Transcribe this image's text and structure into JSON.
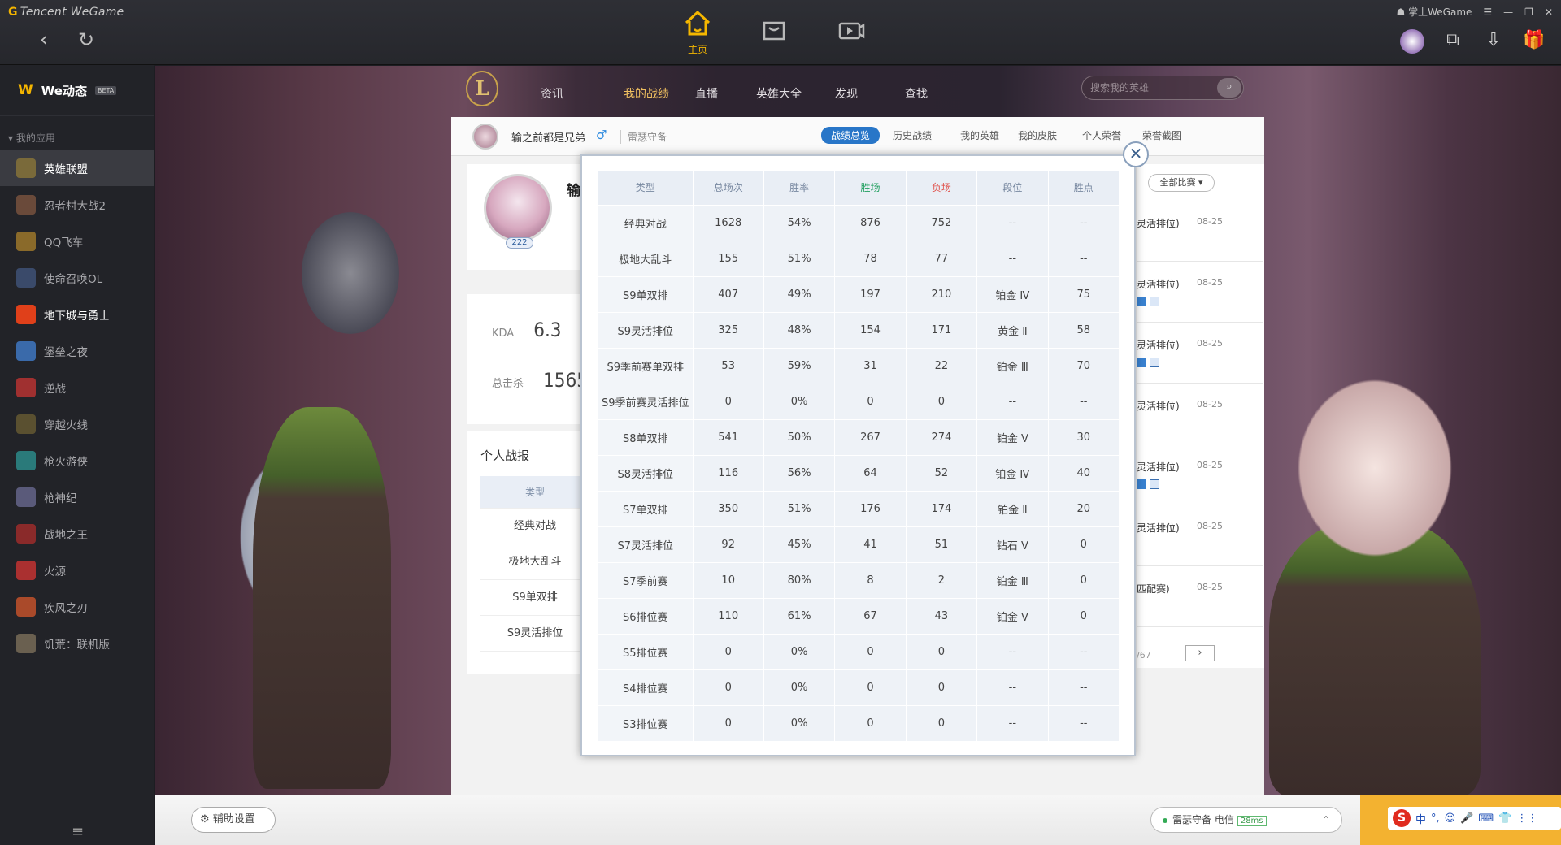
{
  "topbar": {
    "brand": "Tencent WeGame",
    "home_label": "主页",
    "window_right": {
      "login": "掌上WeGame",
      "menu": "☰",
      "min": "—",
      "max": "❐",
      "close": "✕"
    }
  },
  "sidebar": {
    "we_title": "We动态",
    "beta": "BETA",
    "section": "▾ 我的应用",
    "items": [
      {
        "label": "英雄联盟",
        "color": "#7a6a3a"
      },
      {
        "label": "忍者村大战2",
        "color": "#6a4a3a"
      },
      {
        "label": "QQ飞车",
        "color": "#8a6a2a"
      },
      {
        "label": "使命召唤OL",
        "color": "#3a4a6a"
      },
      {
        "label": "地下城与勇士",
        "color": "#e0401a"
      },
      {
        "label": "堡垒之夜",
        "color": "#3a6aaa"
      },
      {
        "label": "逆战",
        "color": "#a03030"
      },
      {
        "label": "穿越火线",
        "color": "#5a5030"
      },
      {
        "label": "枪火游侠",
        "color": "#2a7a7a"
      },
      {
        "label": "枪神纪",
        "color": "#5a5a7a"
      },
      {
        "label": "战地之王",
        "color": "#8a2a2a"
      },
      {
        "label": "火源",
        "color": "#aa3030"
      },
      {
        "label": "疾风之刃",
        "color": "#aa4a2a"
      },
      {
        "label": "饥荒：联机版",
        "color": "#6a6050"
      }
    ]
  },
  "lol": {
    "logo": "L",
    "nav": [
      "资讯",
      "我的战绩",
      "直播",
      "英雄大全",
      "发现",
      "查找"
    ],
    "search_placeholder": "搜索我的英雄"
  },
  "summoner": {
    "name": "输之前都是兄弟",
    "gender": "♂",
    "server": "雷瑟守备",
    "tabs": [
      "战绩总览",
      "历史战绩",
      "我的英雄",
      "我的皮肤",
      "个人荣誉",
      "荣誉截图"
    ],
    "name_fragment": "输",
    "level": "222"
  },
  "kda": {
    "kda_label": "KDA",
    "kda_value": "6.3",
    "kills_label": "总击杀",
    "kills_value": "1565"
  },
  "report": {
    "title": "个人战报",
    "header": "类型",
    "rows": [
      "经典对战",
      "极地大乱斗",
      "S9单双排",
      "S9灵活排位"
    ]
  },
  "matches": {
    "filter": "全部比赛 ▾",
    "rows": [
      {
        "type": "灵活排位)",
        "date": "08-25"
      },
      {
        "type": "灵活排位)",
        "date": "08-25"
      },
      {
        "type": "灵活排位)",
        "date": "08-25"
      },
      {
        "type": "灵活排位)",
        "date": "08-25"
      },
      {
        "type": "灵活排位)",
        "date": "08-25"
      },
      {
        "type": "灵活排位)",
        "date": "08-25"
      },
      {
        "type": "匹配赛)",
        "date": "08-25"
      }
    ],
    "pager": "/67",
    "next": "›"
  },
  "stats": {
    "headers": [
      "类型",
      "总场次",
      "胜率",
      "胜场",
      "负场",
      "段位",
      "胜点"
    ],
    "rows": [
      [
        "经典对战",
        "1628",
        "54%",
        "876",
        "752",
        "--",
        "--"
      ],
      [
        "极地大乱斗",
        "155",
        "51%",
        "78",
        "77",
        "--",
        "--"
      ],
      [
        "S9单双排",
        "407",
        "49%",
        "197",
        "210",
        "铂金 Ⅳ",
        "75"
      ],
      [
        "S9灵活排位",
        "325",
        "48%",
        "154",
        "171",
        "黄金 Ⅱ",
        "58"
      ],
      [
        "S9季前赛单双排",
        "53",
        "59%",
        "31",
        "22",
        "铂金 Ⅲ",
        "70"
      ],
      [
        "S9季前赛灵活排位",
        "0",
        "0%",
        "0",
        "0",
        "--",
        "--"
      ],
      [
        "S8单双排",
        "541",
        "50%",
        "267",
        "274",
        "铂金 Ⅴ",
        "30"
      ],
      [
        "S8灵活排位",
        "116",
        "56%",
        "64",
        "52",
        "铂金 Ⅳ",
        "40"
      ],
      [
        "S7单双排",
        "350",
        "51%",
        "176",
        "174",
        "铂金 Ⅱ",
        "20"
      ],
      [
        "S7灵活排位",
        "92",
        "45%",
        "41",
        "51",
        "钻石 Ⅴ",
        "0"
      ],
      [
        "S7季前赛",
        "10",
        "80%",
        "8",
        "2",
        "铂金 Ⅲ",
        "0"
      ],
      [
        "S6排位赛",
        "110",
        "61%",
        "67",
        "43",
        "铂金 Ⅴ",
        "0"
      ],
      [
        "S5排位赛",
        "0",
        "0%",
        "0",
        "0",
        "--",
        "--"
      ],
      [
        "S4排位赛",
        "0",
        "0%",
        "0",
        "0",
        "--",
        "--"
      ],
      [
        "S3排位赛",
        "0",
        "0%",
        "0",
        "0",
        "--",
        "--"
      ]
    ],
    "close": "✕"
  },
  "bottom": {
    "assist": "辅助设置",
    "server": "雷瑟守备 电信",
    "ping": "28ms",
    "ime": [
      "中",
      "°,",
      "☺",
      "🎤",
      "⌨",
      "👕",
      "⋮⋮"
    ]
  },
  "colors": {
    "accent": "#f5b700",
    "win": "#22a060",
    "lose": "#e0504a",
    "tab_active": "#2876c8"
  }
}
